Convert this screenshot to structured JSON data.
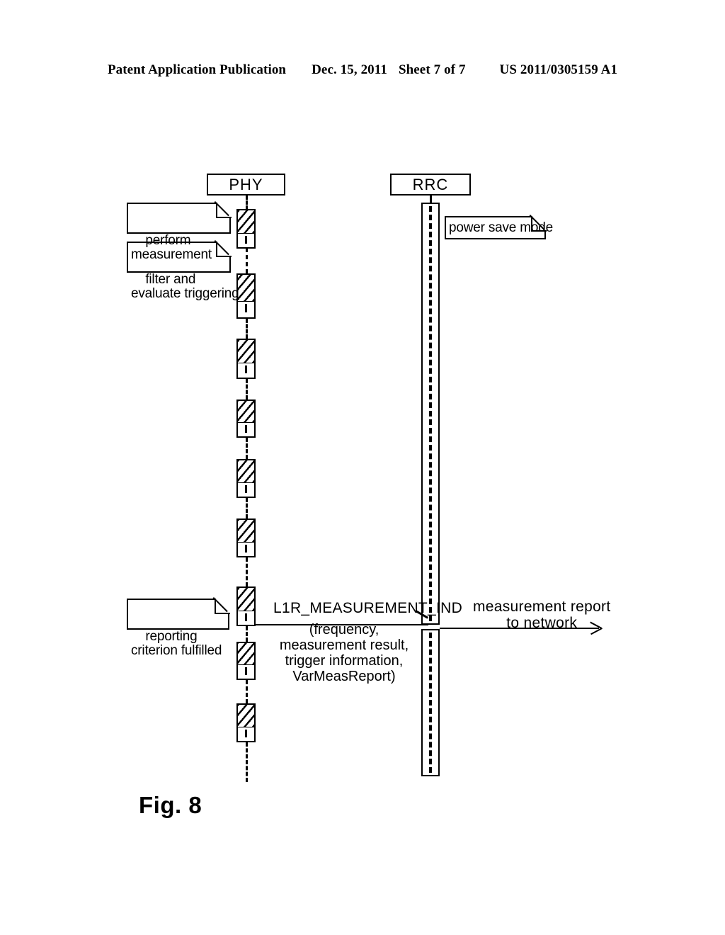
{
  "header": {
    "publication": "Patent Application Publication",
    "date": "Dec. 15, 2011",
    "sheet": "Sheet 7 of 7",
    "patent_number": "US 2011/0305159 A1"
  },
  "figure": {
    "caption": "Fig. 8",
    "type": "uml-sequence-diagram"
  },
  "lifelines": [
    {
      "id": "phy",
      "label": "PHY"
    },
    {
      "id": "rrc",
      "label": "RRC"
    }
  ],
  "notes": [
    {
      "id": "note-perform-measurement",
      "text": "perform\nmeasurement"
    },
    {
      "id": "note-filter-evaluate",
      "text": "filter and\nevaluate triggering"
    },
    {
      "id": "note-power-save-mode",
      "text": "power save mode"
    },
    {
      "id": "note-reporting-criterion",
      "text": "reporting\ncriterion fulfilled"
    }
  ],
  "messages": [
    {
      "id": "l1r-measurement-ind",
      "label": "L1R_MEASUREMENT_IND",
      "parameters": "(frequency,\nmeasurement result,\ntrigger information,\nVarMeasReport)",
      "from": "phy",
      "to": "rrc"
    },
    {
      "id": "measurement-report-to-network",
      "label": "measurement report\nto network",
      "parameters": "",
      "from": "rrc",
      "to": "network"
    }
  ],
  "colors": {
    "ink": "#000000",
    "paper": "#ffffff"
  }
}
